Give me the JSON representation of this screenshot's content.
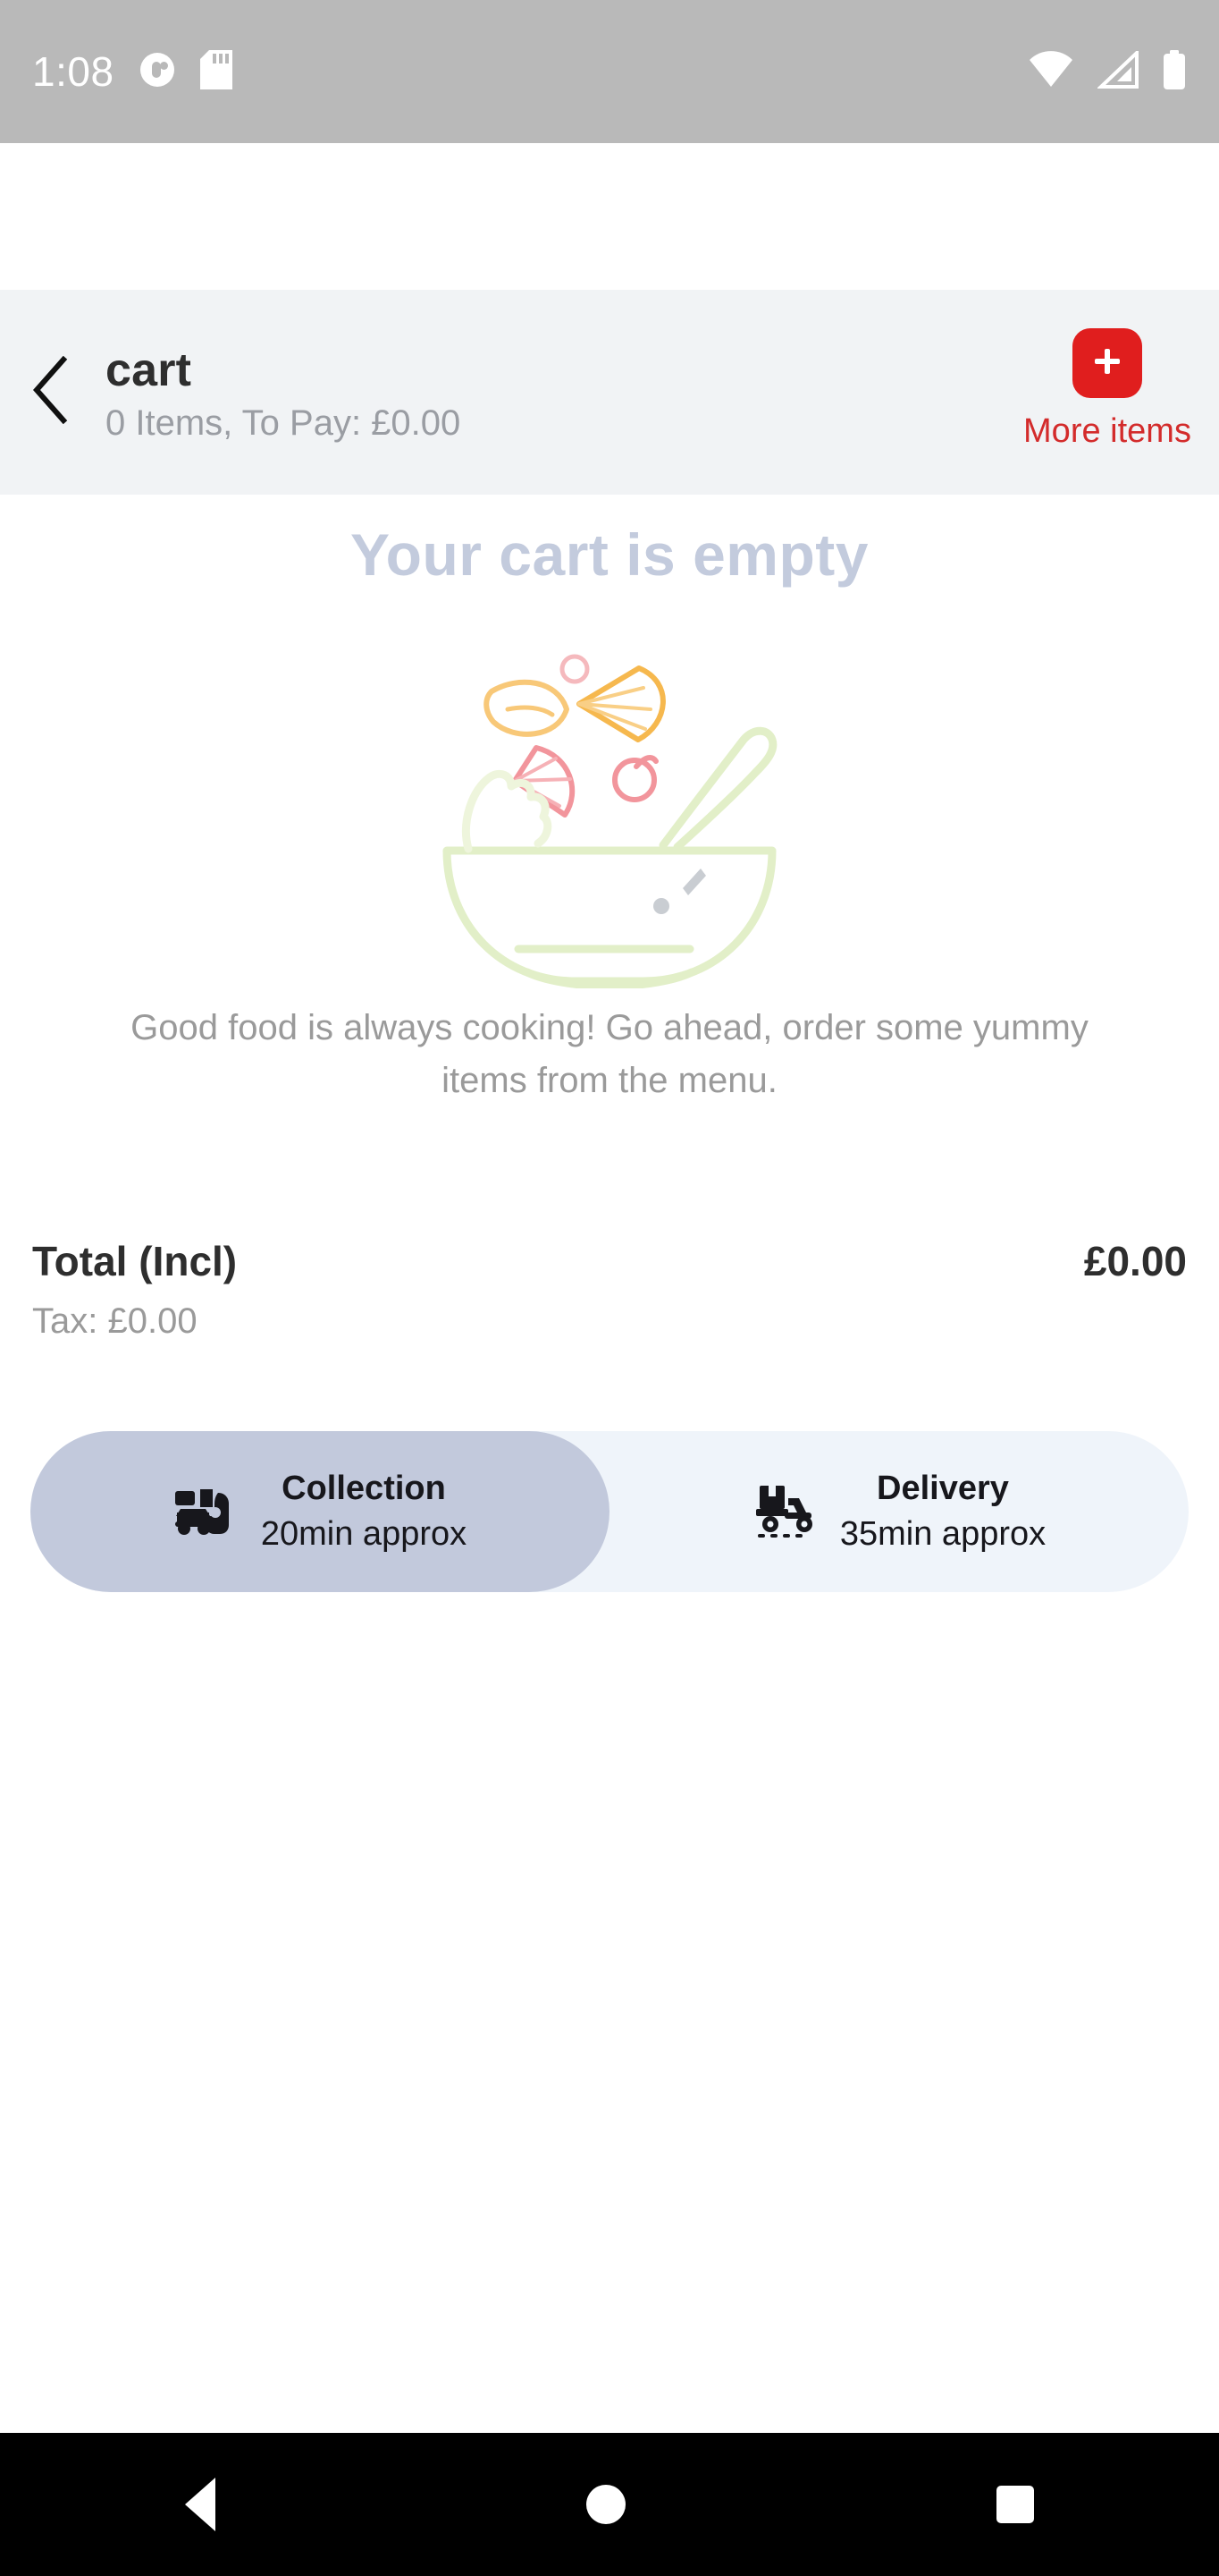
{
  "status_bar": {
    "time": "1:08",
    "left_icons": [
      "notification-circle-icon",
      "sd-card-icon"
    ],
    "right_icons": [
      "wifi-icon",
      "cellular-signal-icon",
      "battery-icon"
    ],
    "background_color": "#b9b9b9"
  },
  "header": {
    "back_icon": "chevron-left-icon",
    "title": "cart",
    "subtitle": "0 Items, To Pay: £0.00",
    "more_items": {
      "icon": "plus-icon",
      "label": "More items",
      "button_color": "#e01e1e",
      "label_color": "#d32b2b"
    },
    "background_color": "#f1f3f5"
  },
  "empty_state": {
    "title": "Your cart is empty",
    "title_color": "#c3cbdd",
    "illustration": "salad-bowl-illustration",
    "description": "Good food is always cooking! Go ahead, order some yummy items from the menu.",
    "description_color": "#9a9a9a"
  },
  "totals": {
    "total_label": "Total (Incl)",
    "total_value": "£0.00",
    "tax_label": "Tax: £0.00"
  },
  "mode_toggle": {
    "selected": "Collection",
    "selected_color": "#c2c9dc",
    "track_color": "#eff4fa",
    "options": [
      {
        "name": "Collection",
        "eta": "20min approx",
        "icon": "car-pickup-icon",
        "selected": true
      },
      {
        "name": "Delivery",
        "eta": "35min approx",
        "icon": "scooter-delivery-icon",
        "selected": false
      }
    ]
  },
  "nav_bar": {
    "items": [
      "back-triangle-icon",
      "home-circle-icon",
      "recents-square-icon"
    ],
    "background_color": "#000000"
  }
}
